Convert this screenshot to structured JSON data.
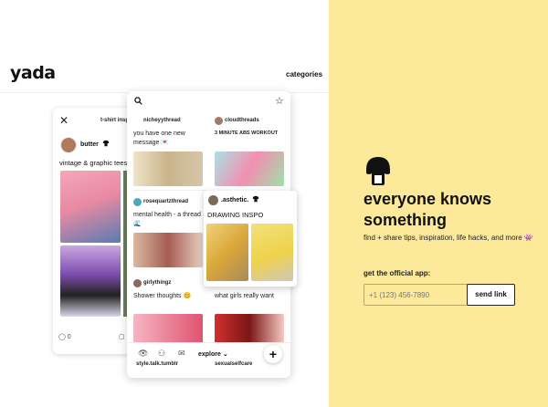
{
  "brand": {
    "logo": "yada"
  },
  "header": {
    "categories_label": "categories"
  },
  "thread_card": {
    "title": "t-shirt insp",
    "username": "butter",
    "text": "vintage & graphic tees",
    "comment_count": "0"
  },
  "feed": {
    "cards": [
      {
        "user": "nicheyythread",
        "text": "you have one new message 💌",
        "color_a": "#efe3c8",
        "color_b": "#c9b48a"
      },
      {
        "user": "cloudthreads",
        "text": "3 MINUTE ABS WORKOUT",
        "color_a": "#a9e3e6",
        "color_b": "#f28fb0"
      },
      {
        "user": "rosequartzthread",
        "text": "mental health - a thread 🌊",
        "color_a": "#d9b9a2",
        "color_b": "#a55d53"
      },
      {
        "user": "girlythingz",
        "text": "Shower thoughts 😊",
        "color_a": "#f5b5c3",
        "color_b": "#e0536f"
      },
      {
        "user": "",
        "text": "what girls really want",
        "color_a": "#d0302f",
        "color_b": "#f6c9c3"
      }
    ],
    "footer_names": [
      "style.talk.tumblr",
      "sexualselfcare"
    ],
    "nav": {
      "explore_label": "explore",
      "add_label": "+"
    }
  },
  "popup": {
    "user": ".asthetic.",
    "text": "DRAWING INSPO"
  },
  "promo": {
    "headline": "everyone knows something",
    "subtitle": "find + share tips, inspiration, life hacks, and more 👾",
    "get_app_label": "get the official app:",
    "phone_placeholder": "+1 (123) 456-7890",
    "send_label": "send link"
  },
  "colors": {
    "promo_bg": "#fde99a",
    "text": "#111111"
  }
}
